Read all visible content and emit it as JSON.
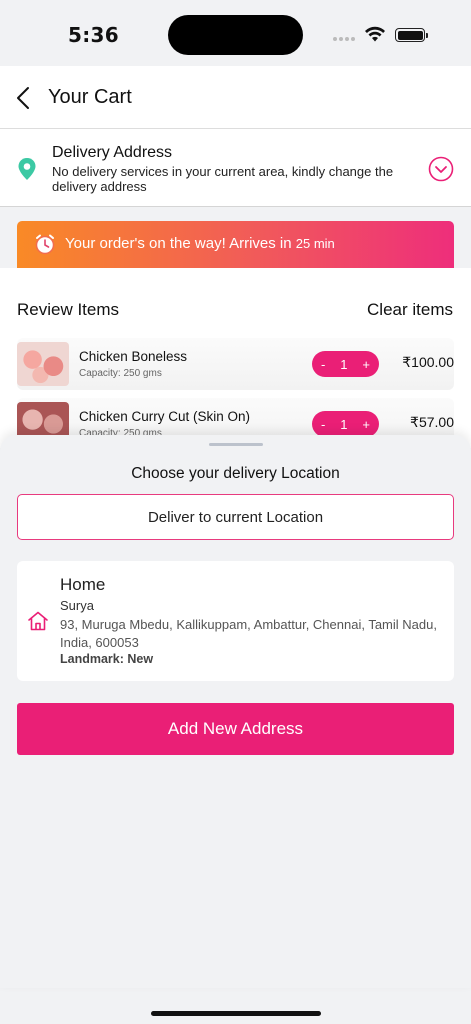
{
  "status_bar": {
    "time": "5:36"
  },
  "header": {
    "title": "Your Cart"
  },
  "delivery": {
    "title": "Delivery Address",
    "message": "No delivery services in your current area, kindly change the delivery address"
  },
  "banner": {
    "text": "Your order's on the way! Arrives in ",
    "eta": "25 min"
  },
  "review": {
    "title": "Review Items",
    "clear_label": "Clear items",
    "items": [
      {
        "name": "Chicken Boneless",
        "capacity": "Capacity: 250 gms",
        "qty": "1",
        "minus": "-",
        "plus": "+",
        "price": "₹100.00"
      },
      {
        "name": "Chicken Curry Cut (Skin On)",
        "capacity": "Capacity: 250 gms",
        "qty": "1",
        "minus": "-",
        "plus": "+",
        "price": "₹57.00"
      }
    ]
  },
  "sheet": {
    "title": "Choose your delivery Location",
    "current_location_label": "Deliver to current Location",
    "address": {
      "label": "Home",
      "name": "Surya",
      "line": "93, Muruga Mbedu, Kallikuppam, Ambattur, Chennai, Tamil Nadu, India, 600053",
      "landmark": "Landmark: New"
    },
    "add_label": "Add New Address"
  },
  "colors": {
    "accent": "#ea1f76",
    "pin": "#3cc9a4",
    "banner_start": "#f98a26",
    "banner_end": "#ee2e7b"
  }
}
